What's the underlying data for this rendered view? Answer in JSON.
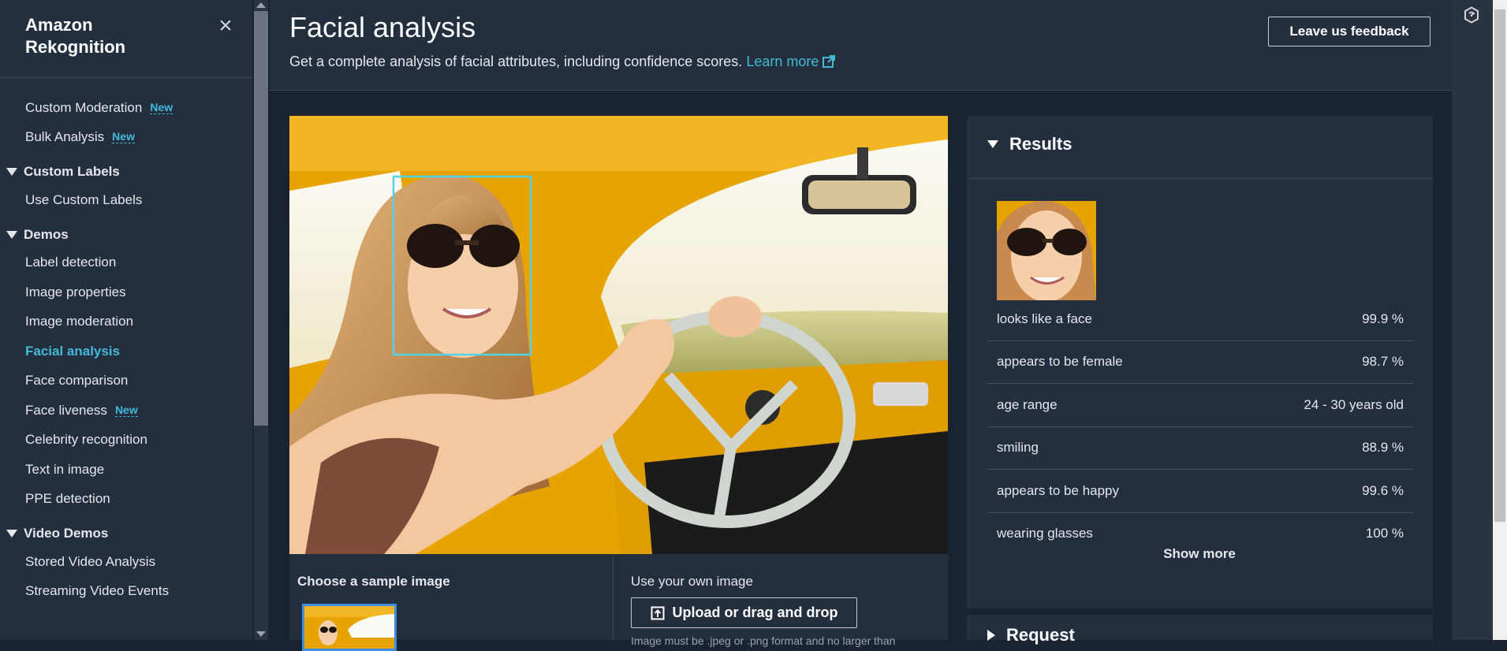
{
  "sidebar": {
    "brand_line1": "Amazon",
    "brand_line2": "Rekognition",
    "close_glyph": "×",
    "top_items": [
      {
        "label": "Custom Moderation",
        "badge": "New"
      },
      {
        "label": "Bulk Analysis",
        "badge": "New"
      }
    ],
    "sections": [
      {
        "title": "Custom Labels",
        "items": [
          "Use Custom Labels"
        ]
      },
      {
        "title": "Demos",
        "items": [
          "Label detection",
          "Image properties",
          "Image moderation",
          "Facial analysis",
          "Face comparison",
          "Face liveness",
          "Celebrity recognition",
          "Text in image",
          "PPE detection"
        ]
      },
      {
        "title": "Video Demos",
        "items": [
          "Stored Video Analysis",
          "Streaming Video Events"
        ]
      }
    ],
    "active_item": "Facial analysis",
    "face_liveness_badge": "New"
  },
  "header": {
    "title": "Facial analysis",
    "description": "Get a complete analysis of facial attributes, including confidence scores.",
    "learn_more": "Learn more",
    "feedback_button": "Leave us feedback"
  },
  "image_panel": {
    "choose_sample_label": "Choose a sample image",
    "own_image_label": "Use your own image",
    "upload_button": "Upload or drag and drop",
    "upload_note": "Image must be .jpeg or .png format and no larger than"
  },
  "results": {
    "title": "Results",
    "rows": [
      {
        "label": "looks like a face",
        "value": "99.9 %"
      },
      {
        "label": "appears to be female",
        "value": "98.7 %"
      },
      {
        "label": "age range",
        "value": "24 - 30 years old"
      },
      {
        "label": "smiling",
        "value": "88.9 %"
      },
      {
        "label": "appears to be happy",
        "value": "99.6 %"
      },
      {
        "label": "wearing glasses",
        "value": "100 %"
      }
    ],
    "show_more": "Show more"
  },
  "request": {
    "title": "Request"
  },
  "colors": {
    "accent": "#44b9d6",
    "face_box": "#56d2e6",
    "sample_border": "#3d8ee0"
  }
}
